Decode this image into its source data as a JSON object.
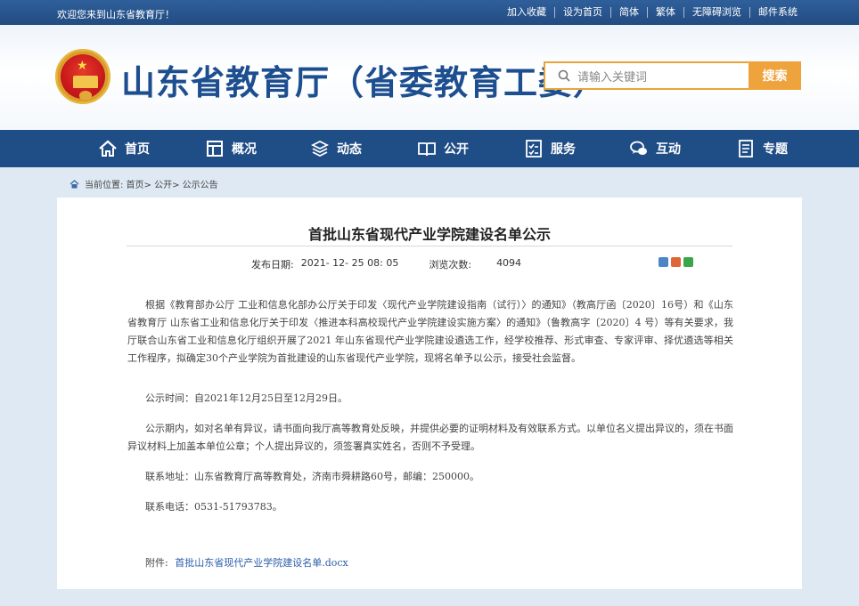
{
  "topbar": {
    "welcome": "欢迎您来到山东省教育厅！",
    "links": [
      "加入收藏",
      "设为首页",
      "简体",
      "繁体",
      "无障碍浏览",
      "邮件系统"
    ]
  },
  "header": {
    "site_title": "山东省教育厅（省委教育工委）",
    "search_placeholder": "请输入关键词",
    "search_button": "搜索"
  },
  "nav": [
    {
      "label": "首页",
      "icon": "home-icon"
    },
    {
      "label": "概况",
      "icon": "window-icon"
    },
    {
      "label": "动态",
      "icon": "stack-icon"
    },
    {
      "label": "公开",
      "icon": "book-icon"
    },
    {
      "label": "服务",
      "icon": "checklist-icon"
    },
    {
      "label": "互动",
      "icon": "chat-icon"
    },
    {
      "label": "专题",
      "icon": "document-icon"
    }
  ],
  "breadcrumb": {
    "text": "当前位置: 首页> 公开> 公示公告"
  },
  "article": {
    "title": "首批山东省现代产业学院建设名单公示",
    "publish_label": "发布日期:",
    "publish_date": "2021- 12- 25 08: 05",
    "views_label": "浏览次数:",
    "views": "4094",
    "paragraphs": [
      "根据《教育部办公厅  工业和信息化部办公厅关于印发〈现代产业学院建设指南（试行）〉的通知》（教高厅函〔2020〕16号）和《山东省教育厅  山东省工业和信息化厅关于印发〈推进本科高校现代产业学院建设实施方案〉的通知》（鲁教高字〔2020〕4 号）等有关要求，我厅联合山东省工业和信息化厅组织开展了2021 年山东省现代产业学院建设遴选工作，经学校推荐、形式审查、专家评审、择优遴选等相关工作程序，拟确定30个产业学院为首批建设的山东省现代产业学院，现将名单予以公示，接受社会监督。",
      "公示时间：自2021年12月25日至12月29日。",
      "公示期内，如对名单有异议，请书面向我厅高等教育处反映，并提供必要的证明材料及有效联系方式。以单位名义提出异议的，须在书面异议材料上加盖本单位公章；个人提出异议的，须签署真实姓名，否则不予受理。",
      "联系地址：山东省教育厅高等教育处，济南市舜耕路60号，邮编：250000。",
      "联系电话：0531-51793783。"
    ],
    "attachment_label": "附件:",
    "attachment_file": "首批山东省现代产业学院建设名单.docx"
  },
  "colors": {
    "nav_bg": "#1f4d86",
    "title_blue": "#1d4e8f",
    "search_orange": "#eea33c",
    "link_blue": "#2a5caa"
  }
}
